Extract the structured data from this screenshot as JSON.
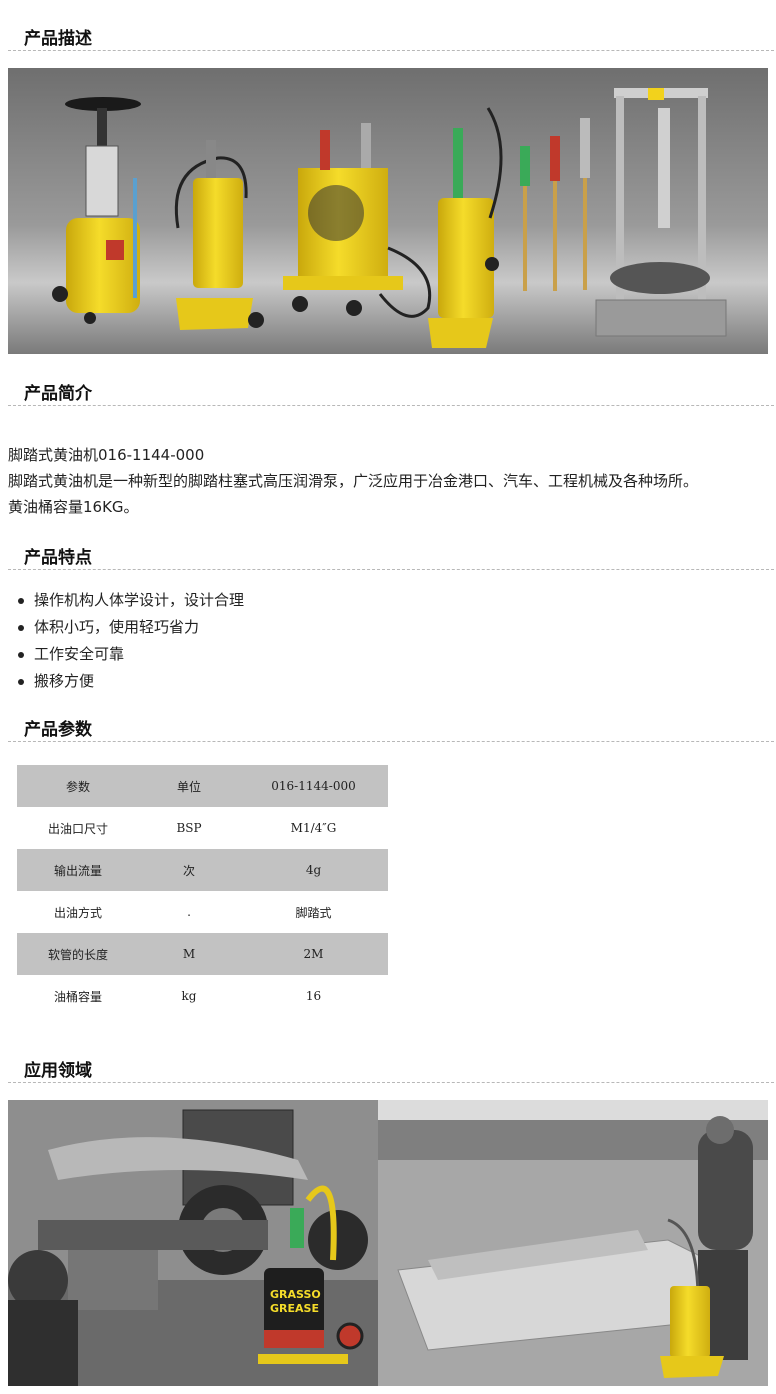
{
  "sections": {
    "description": "产品描述",
    "intro": "产品简介",
    "features": "产品特点",
    "params": "产品参数",
    "applications": "应用领域"
  },
  "intro": {
    "line1": "脚踏式黄油机016-1144-000",
    "line2": "脚踏式黄油机是一种新型的脚踏柱塞式高压润滑泵，广泛应用于冶金港口、汽车、工程机械及各种场所。",
    "line3": "黄油桶容量16KG。"
  },
  "features": [
    "操作机构人体学设计，设计合理",
    "体积小巧，使用轻巧省力",
    "工作安全可靠",
    "搬移方便"
  ],
  "params_table": {
    "header": [
      "参数",
      "单位",
      "016-1144-000"
    ],
    "rows": [
      [
        "出油口尺寸",
        "BSP",
        "M1/4″G"
      ],
      [
        "输出流量",
        "次",
        "4g"
      ],
      [
        "出油方式",
        ".",
        "脚踏式"
      ],
      [
        "软管的长度",
        "M",
        "2M"
      ],
      [
        "油桶容量",
        "kg",
        "16"
      ]
    ]
  },
  "product_photo": {
    "bucket_text": "GRASSO GREASE"
  },
  "colors": {
    "brand_yellow": "#f2d21c",
    "table_stripe": "#c2c2c2"
  }
}
